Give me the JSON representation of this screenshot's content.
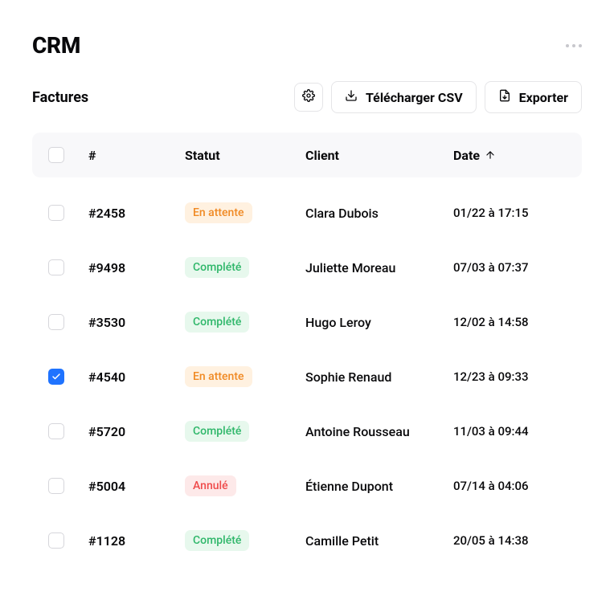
{
  "app": {
    "title": "CRM"
  },
  "section": {
    "label": "Factures"
  },
  "toolbar": {
    "download_csv_label": "Télécharger CSV",
    "export_label": "Exporter"
  },
  "table": {
    "columns": {
      "id": "#",
      "status": "Statut",
      "client": "Client",
      "date": "Date"
    },
    "sort": {
      "column": "date",
      "direction": "asc"
    },
    "rows": [
      {
        "checked": false,
        "id": "#2458",
        "status": "En attente",
        "status_kind": "pending",
        "client": "Clara Dubois",
        "date": "01/22 à 17:15"
      },
      {
        "checked": false,
        "id": "#9498",
        "status": "Complété",
        "status_kind": "complete",
        "client": "Juliette Moreau",
        "date": "07/03 à 07:37"
      },
      {
        "checked": false,
        "id": "#3530",
        "status": "Complété",
        "status_kind": "complete",
        "client": "Hugo Leroy",
        "date": "12/02 à 14:58"
      },
      {
        "checked": true,
        "id": "#4540",
        "status": "En attente",
        "status_kind": "pending",
        "client": "Sophie Renaud",
        "date": "12/23 à 09:33"
      },
      {
        "checked": false,
        "id": "#5720",
        "status": "Complété",
        "status_kind": "complete",
        "client": "Antoine Rousseau",
        "date": "11/03 à 09:44"
      },
      {
        "checked": false,
        "id": "#5004",
        "status": "Annulé",
        "status_kind": "cancel",
        "client": "Étienne Dupont",
        "date": "07/14 à 04:06"
      },
      {
        "checked": false,
        "id": "#1128",
        "status": "Complété",
        "status_kind": "complete",
        "client": "Camille Petit",
        "date": "20/05 à 14:38"
      }
    ]
  }
}
